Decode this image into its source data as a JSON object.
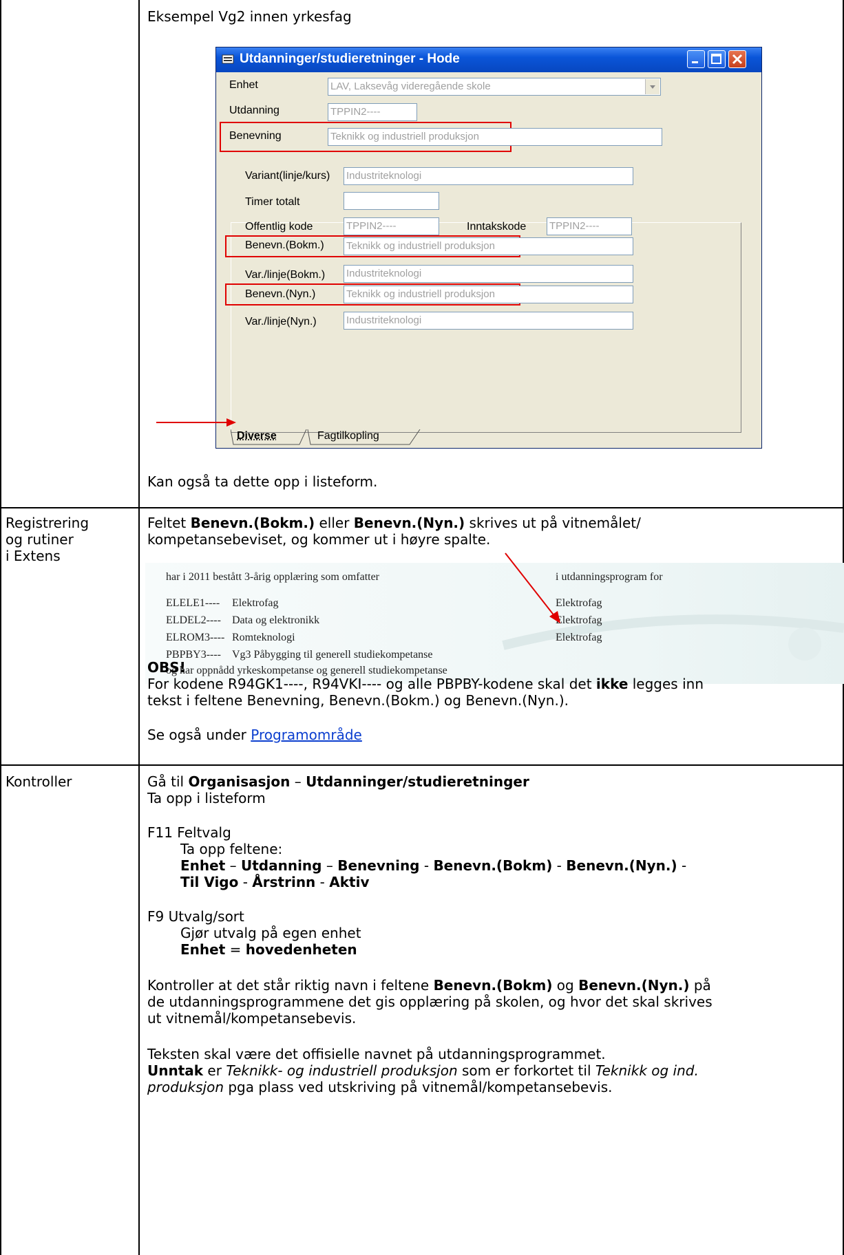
{
  "top_cell": {
    "heading": "Eksempel Vg2 innen yrkesfag",
    "footer": "Kan også ta dette opp i listeform."
  },
  "dialog": {
    "title": "Utdanninger/studieretninger - Hode",
    "fields": {
      "enhet_label": "Enhet",
      "enhet_value": "LAV, Laksevåg videregående skole",
      "utdanning_label": "Utdanning",
      "utdanning_value": "TPPIN2----",
      "benevning_label": "Benevning",
      "benevning_value": "Teknikk og industriell produksjon",
      "variant_label": "Variant(linje/kurs)",
      "variant_value": "Industriteknologi",
      "timer_label": "Timer totalt",
      "timer_value": "",
      "offentlig_label": "Offentlig kode",
      "offentlig_value": "TPPIN2----",
      "inntak_label": "Inntakskode",
      "inntak_value": "TPPIN2----",
      "benevn_bokm_label": "Benevn.(Bokm.)",
      "benevn_bokm_value": "Teknikk og industriell produksjon",
      "var_bokm_label": "Var./linje(Bokm.)",
      "var_bokm_value": "Industriteknologi",
      "benevn_nyn_label": "Benevn.(Nyn.)",
      "benevn_nyn_value": "Teknikk og industriell produksjon",
      "var_nyn_label": "Var./linje(Nyn.)",
      "var_nyn_value": "Industriteknologi"
    },
    "tabs": [
      "Diverse",
      "Fagtilkopling"
    ]
  },
  "row2": {
    "label_lines": [
      "Registrering",
      "og rutiner",
      "i Extens"
    ],
    "p1_a": "Feltet ",
    "p1_b": "Benevn.(Bokm.)",
    "p1_c": " eller ",
    "p1_d": "Benevn.(Nyn.)",
    "p1_e": " skrives ut på vitnemålet/",
    "p1_line2": "kompetansebeviset, og kommer ut i høyre spalte.",
    "certificate": {
      "header_left": "har i 2011 bestått 3-årig opplæring som omfatter",
      "header_right": "i utdanningsprogram for",
      "rows": [
        {
          "code": "ELELE1----",
          "name": "Elektrofag",
          "program": "Elektrofag"
        },
        {
          "code": "ELDEL2----",
          "name": "Data og elektronikk",
          "program": "Elektrofag"
        },
        {
          "code": "ELROM3----",
          "name": "Romteknologi",
          "program": "Elektrofag"
        },
        {
          "code": "PBPBY3----",
          "name": "Vg3 Påbygging til generell studiekompetanse",
          "program": ""
        }
      ],
      "footer": "og har oppnådd yrkeskompetanse og generell studiekompetanse"
    },
    "obs": "OBS!",
    "obs_l1_a": "For kodene R94GK1----, R94VKI---- og alle PBPBY-kodene skal det ",
    "obs_l1_b": "ikke",
    "obs_l1_c": " legges inn",
    "obs_l2": "tekst i feltene Benevning, Benevn.(Bokm.) og Benevn.(Nyn.).",
    "see_also": "Se også under ",
    "see_link": "Programområde"
  },
  "row3": {
    "label": "Kontroller",
    "l1_a": "Gå til ",
    "l1_b": "Organisasjon",
    "l1_c": " – ",
    "l1_d": "Utdanninger/studieretninger",
    "l2": "Ta opp i listeform",
    "f11": "F11 Feltvalg",
    "f11_sub": "Ta opp feltene:",
    "fields_line1": [
      "Enhet",
      " – ",
      "Utdanning",
      " – ",
      "Benevning",
      " - ",
      "Benevn.(Bokm)",
      " - ",
      "Benevn.(Nyn.)",
      " -"
    ],
    "fields_line2": [
      "Til Vigo",
      " - ",
      "Årstrinn",
      " - ",
      "Aktiv"
    ],
    "f9": "F9 Utvalg/sort",
    "f9_sub": "Gjør utvalg på egen enhet",
    "f9_enhet_a": "Enhet",
    "f9_enhet_b": " = ",
    "f9_enhet_c": "hovedenheten",
    "k1_a": "Kontroller at det står riktig navn i feltene ",
    "k1_b": "Benevn.(Bokm)",
    "k1_c": " og ",
    "k1_d": "Benevn.(Nyn.)",
    "k1_e": " på",
    "k2": "de utdanningsprogrammene det gis opplæring på skolen, og hvor det skal skrives",
    "k3": "ut vitnemål/kompetansebevis.",
    "t1": "Teksten skal være det offisielle navnet på utdanningsprogrammet.",
    "t2_a": "Unntak",
    "t2_b": " er ",
    "t2_c": "Teknikk- og industriell produksjon",
    "t2_d": " som er forkortet til ",
    "t2_e": "Teknikk og ind.",
    "t3_a": "produksjon",
    "t3_b": " pga plass ved utskriving på vitnemål/kompetansebevis."
  },
  "colors": {
    "red": "#e00000",
    "link": "#0b3ecf",
    "xp_title": "#0a55d8"
  }
}
